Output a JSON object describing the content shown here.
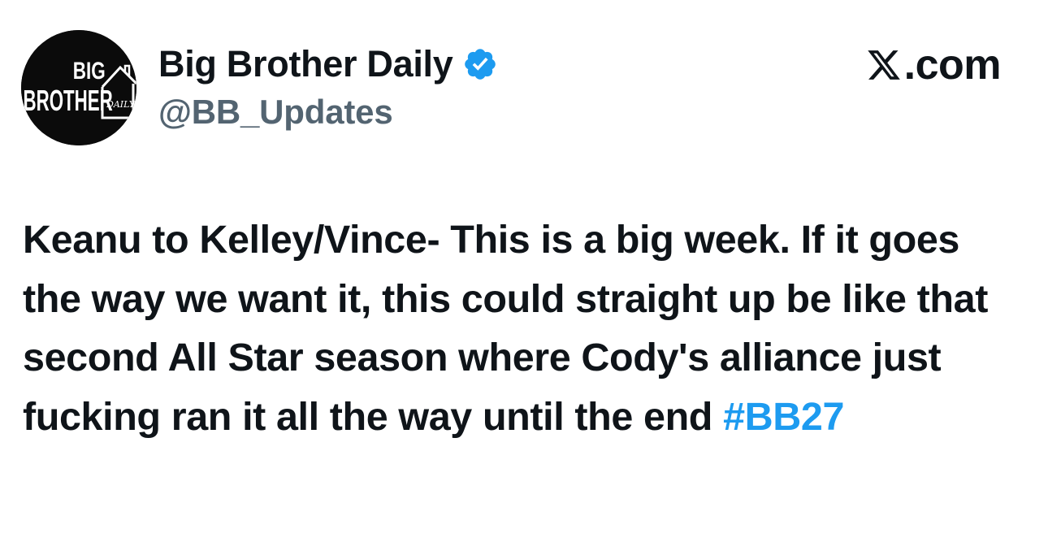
{
  "account": {
    "display_name": "Big Brother Daily",
    "handle": "@BB_Updates",
    "verified": true,
    "avatar": {
      "icon": "big-brother-daily-logo",
      "text_big": "BIG",
      "text_brother": "BROTHER",
      "text_daily": "DAILY"
    }
  },
  "brand": {
    "label": ".com",
    "icon": "x-logo-icon"
  },
  "tweet": {
    "text": "Keanu to Kelley/Vince- This is a big week. If it goes the way we want it, this could straight up be like that second All Star season where Cody's alliance just fucking ran it all the way until the end ",
    "hashtag": "#BB27"
  },
  "colors": {
    "text": "#0f1419",
    "secondary": "#536471",
    "link": "#1d9bf0",
    "verified": "#1d9bf0",
    "background": "#ffffff"
  }
}
